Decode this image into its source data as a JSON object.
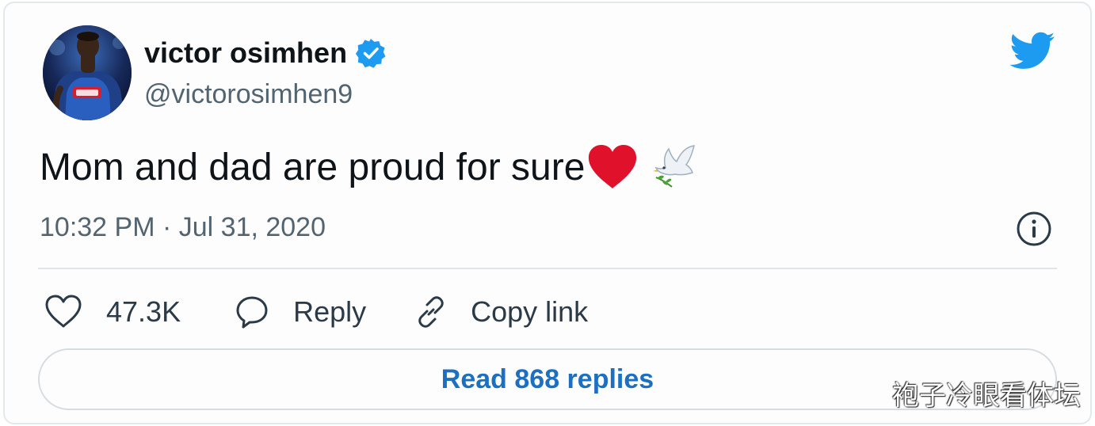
{
  "author": {
    "display_name": "victor osimhen",
    "handle": "@victorosimhen9",
    "verified": true
  },
  "tweet": {
    "text": "Mom and dad are proud for sure",
    "emojis": [
      "red-heart",
      "dove"
    ],
    "timestamp": "10:32 PM · Jul 31, 2020"
  },
  "actions": {
    "like_count": "47.3K",
    "reply_label": "Reply",
    "copy_link_label": "Copy link"
  },
  "read_replies_label": "Read 868 replies",
  "watermark": "袍子冷眼看体坛",
  "colors": {
    "twitter_blue": "#1d9bf0",
    "link_blue": "#1d6fc2",
    "heart_red": "#e0112b",
    "text_primary": "#0f1419",
    "text_secondary": "#536471"
  },
  "icons": {
    "brand": "twitter-bird-icon",
    "verified": "verified-badge-icon",
    "info": "info-icon",
    "like": "heart-outline-icon",
    "reply": "speech-bubble-icon",
    "copy": "link-chain-icon"
  }
}
